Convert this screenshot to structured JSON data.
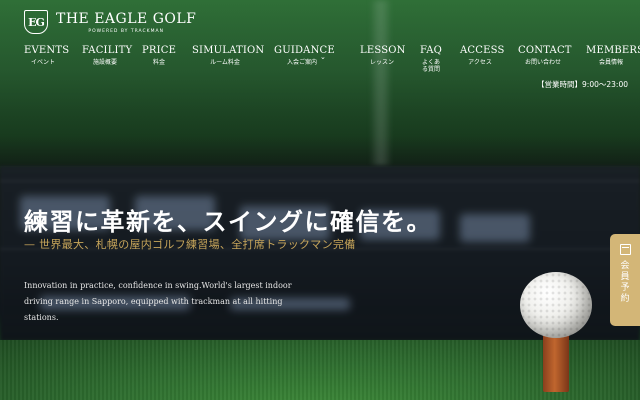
{
  "brand": {
    "logo_mark": "EG",
    "title": "THE EAGLE GOLF",
    "subtitle": "POWERED BY TRACKMAN"
  },
  "nav": {
    "items": [
      {
        "en": "EVENTS",
        "jp": "イベント"
      },
      {
        "en": "FACILITY",
        "jp": "施設概要"
      },
      {
        "en": "PRICE",
        "jp": "料金"
      },
      {
        "en": "SIMULATION",
        "jp": "ルーム料金"
      },
      {
        "en": "GUIDANCE",
        "jp": "入会ご案内"
      },
      {
        "en": "LESSON",
        "jp": "レッスン"
      },
      {
        "en": "FAQ",
        "jp": "よくある質問"
      },
      {
        "en": "ACCESS",
        "jp": "アクセス"
      },
      {
        "en": "CONTACT",
        "jp": "お問い合わせ"
      },
      {
        "en": "MEMBERS",
        "jp": "会員情報"
      }
    ],
    "guidance_chevron": "⌄"
  },
  "hours": "【営業時間】9:00～23:00",
  "hero": {
    "headline": "練習に革新を、スイングに確信を。",
    "subhead": "— 世界最大、札幌の屋内ゴルフ練習場、全打席トラックマン完備",
    "description": "Innovation in practice, confidence in swing.World's largest indoor driving range in Sapporo, equipped with trackman at all hitting stations."
  },
  "reserve": {
    "label": "会員予約",
    "icon": "calendar-icon"
  },
  "colors": {
    "accent_gold": "#c7a55a",
    "tab_gold": "#d3b677"
  }
}
